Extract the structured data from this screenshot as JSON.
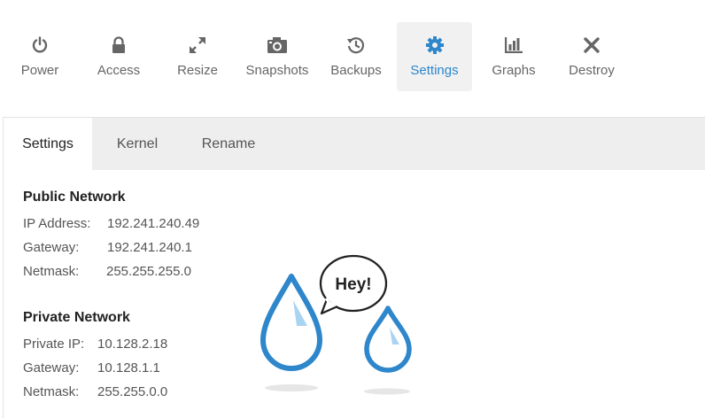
{
  "toolbar": {
    "items": [
      {
        "label": "Power",
        "icon": "power-icon"
      },
      {
        "label": "Access",
        "icon": "lock-icon"
      },
      {
        "label": "Resize",
        "icon": "resize-icon"
      },
      {
        "label": "Snapshots",
        "icon": "camera-icon"
      },
      {
        "label": "Backups",
        "icon": "history-icon"
      },
      {
        "label": "Settings",
        "icon": "gear-icon",
        "active": true
      },
      {
        "label": "Graphs",
        "icon": "bar-chart-icon"
      },
      {
        "label": "Destroy",
        "icon": "close-icon"
      }
    ]
  },
  "tabs": [
    {
      "label": "Settings",
      "active": true
    },
    {
      "label": "Kernel"
    },
    {
      "label": "Rename"
    }
  ],
  "public_network": {
    "title": "Public Network",
    "ip_label": "IP Address:",
    "ip_value": "192.241.240.49",
    "gateway_label": "Gateway:",
    "gateway_value": "192.241.240.1",
    "netmask_label": "Netmask:",
    "netmask_value": "255.255.255.0"
  },
  "private_network": {
    "title": "Private Network",
    "ip_label": "Private IP:",
    "ip_value": "10.128.2.18",
    "gateway_label": "Gateway:",
    "gateway_value": "10.128.1.1",
    "netmask_label": "Netmask:",
    "netmask_value": "255.255.0.0"
  },
  "illustration": {
    "speech": "Hey!",
    "drop_color": "#2e86cb"
  },
  "colors": {
    "accent": "#2e86cb",
    "tabbar_bg": "#eeeeee",
    "active_tool_bg": "#f1f1f1"
  }
}
